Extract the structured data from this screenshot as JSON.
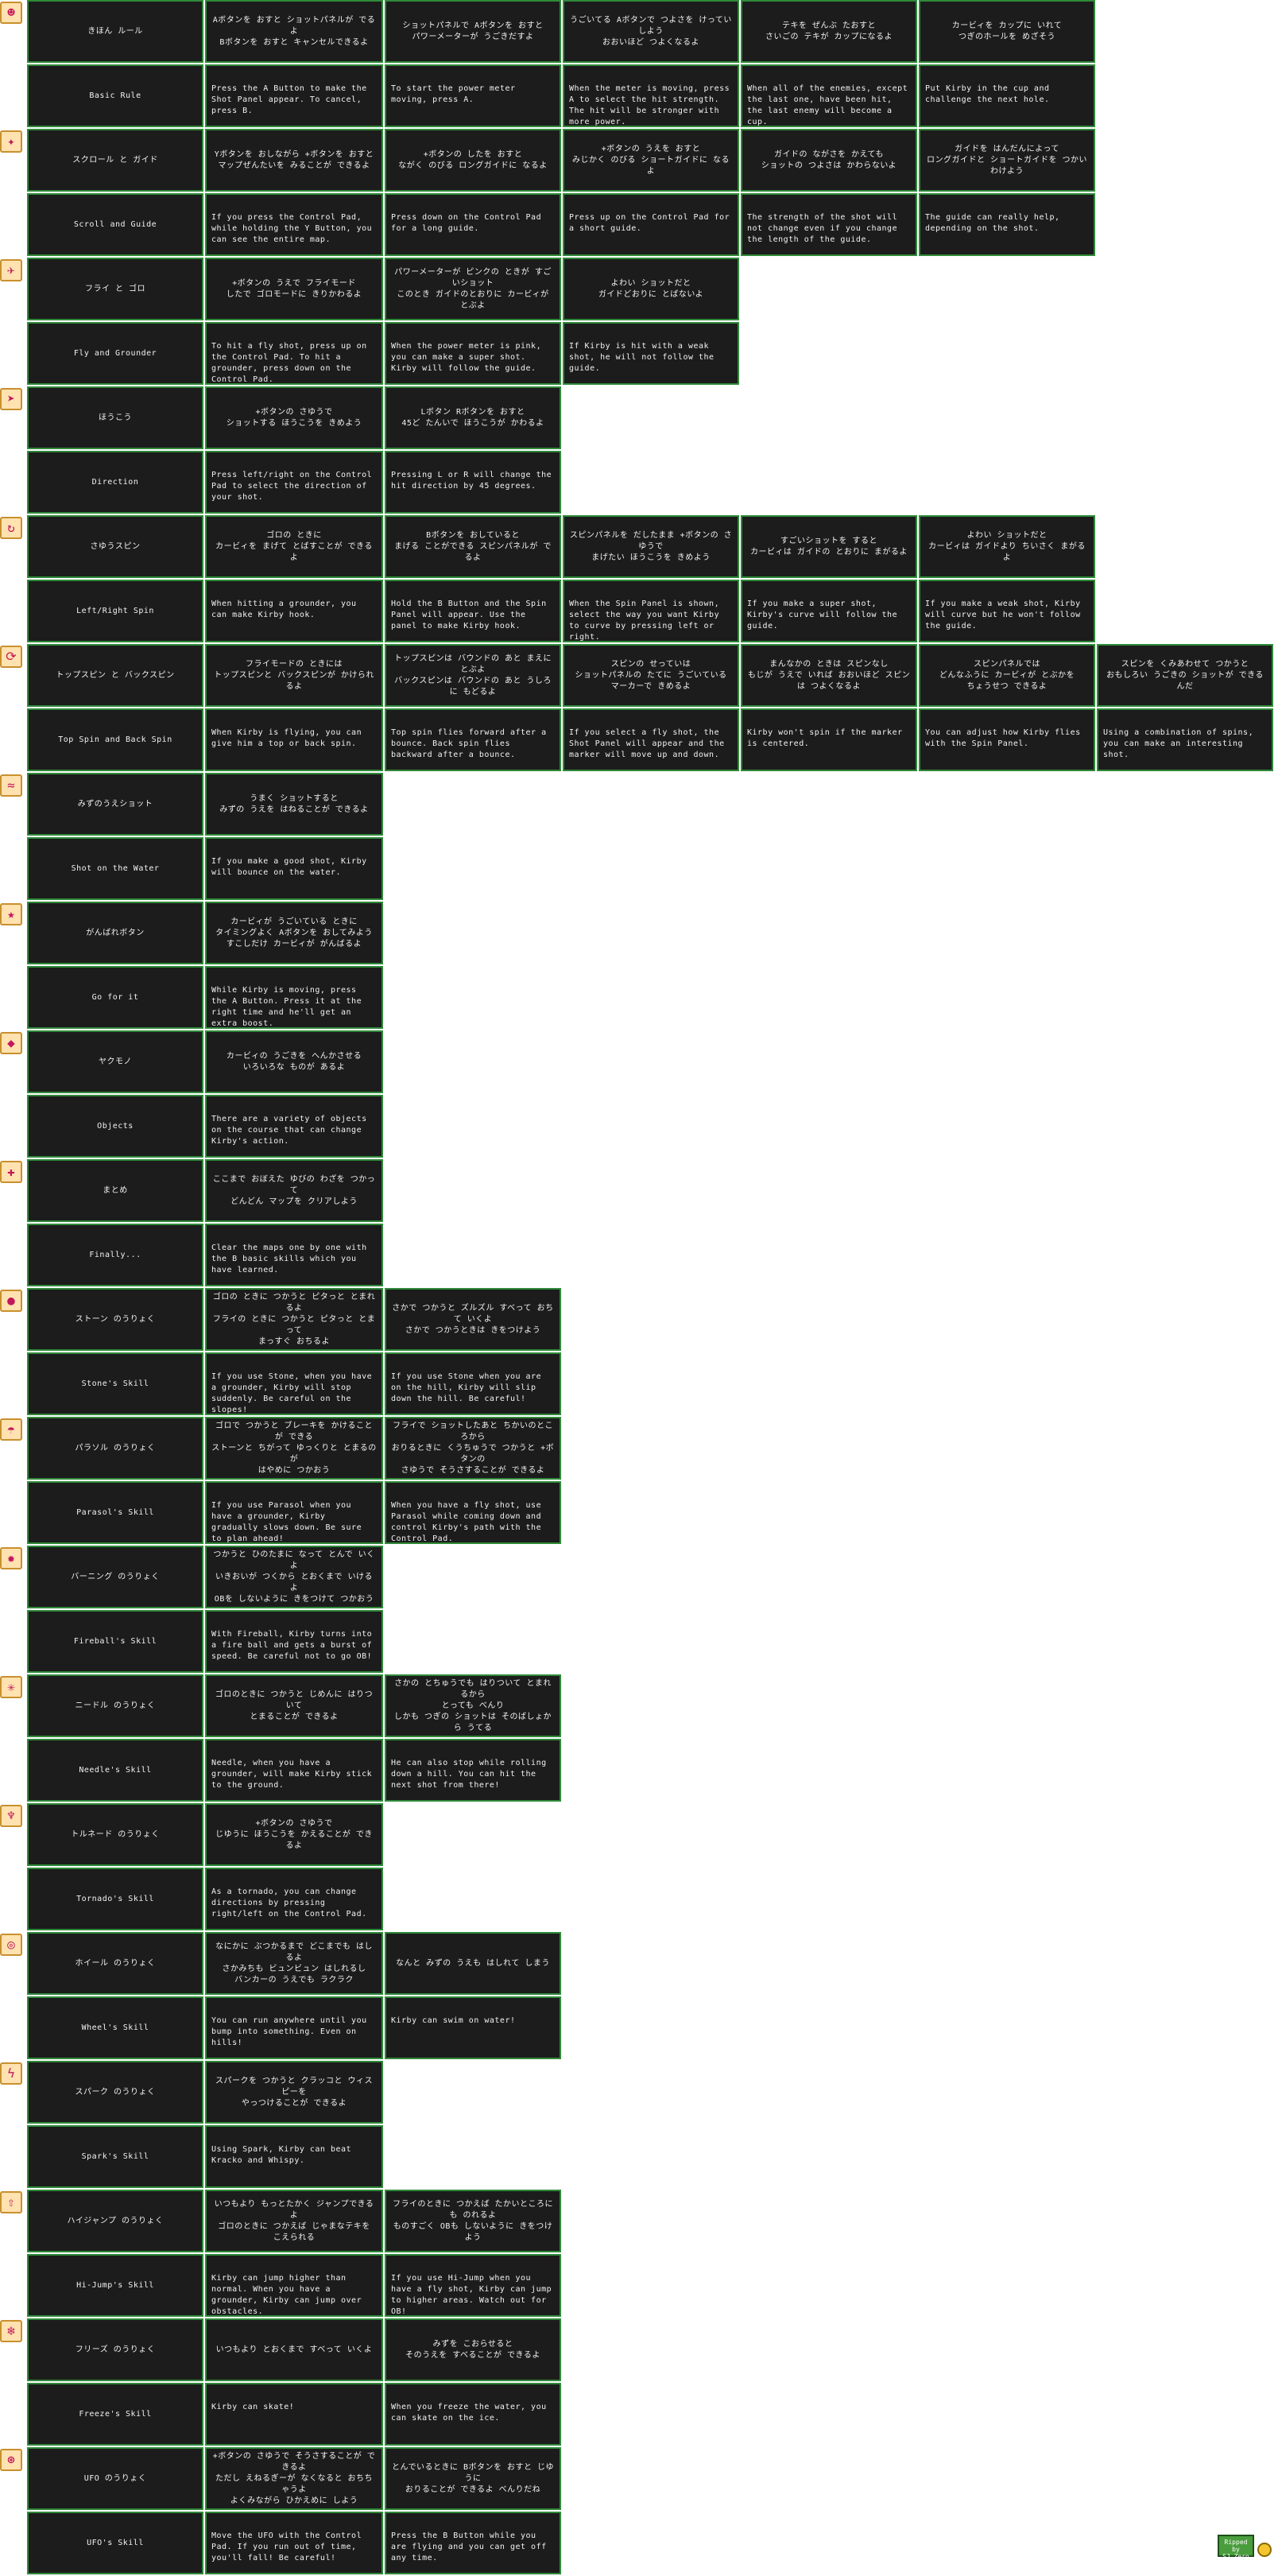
{
  "sections": [
    {
      "icon": "kirby-icon",
      "jp": "きほん ルール",
      "en": "Basic Rule",
      "cells": [
        {
          "jp": "Aボタンを おすと ショットパネルが でるよ\nBボタンを おすと キャンセルできるよ",
          "en": "Press the A Button to make the Shot Panel appear. To cancel, press B."
        },
        {
          "jp": "ショットパネルで Aボタンを おすと\nパワーメーターが うごきだすよ",
          "en": "To start the power meter moving, press A."
        },
        {
          "jp": "うごいてる Aボタンで つよさを けっていしよう\nおおいほど つよくなるよ",
          "en": "When the meter is moving, press A to select the hit strength. The hit will be stronger with more power."
        },
        {
          "jp": "テキを ぜんぶ たおすと\nさいごの テキが カップになるよ",
          "en": "When all of the enemies, except the last one, have been hit, the last enemy will become a cup."
        },
        {
          "jp": "カービィを カップに いれて\nつぎのホールを めざそう",
          "en": "Put Kirby in the cup and challenge the next hole."
        }
      ]
    },
    {
      "icon": "scroll-icon",
      "jp": "スクロール と ガイド",
      "en": "Scroll and Guide",
      "cells": [
        {
          "jp": "Yボタンを おしながら +ボタンを おすと\nマップぜんたいを みることが できるよ",
          "en": "If you press the Control Pad, while holding the Y Button, you can see the entire map."
        },
        {
          "jp": "+ボタンの したを おすと\nながく のびる ロングガイドに なるよ",
          "en": "Press down on the Control Pad for a long guide."
        },
        {
          "jp": "+ボタンの うえを おすと\nみじかく のびる ショートガイドに なるよ",
          "en": "Press up on the Control Pad for a short guide."
        },
        {
          "jp": "ガイドの ながさを かえても\nショットの つよさは かわらないよ",
          "en": "The strength of the shot will not change even if you change the length of the guide."
        },
        {
          "jp": "ガイドを はんだんによって\nロングガイドと ショートガイドを つかいわけよう",
          "en": "The guide can really help, depending on the shot."
        }
      ]
    },
    {
      "icon": "fly-icon",
      "jp": "フライ と ゴロ",
      "en": "Fly and Grounder",
      "cells": [
        {
          "jp": "+ボタンの うえで フライモード\nしたで ゴロモードに きりかわるよ",
          "en": "To hit a fly shot, press up on the Control Pad. To hit a grounder, press down on the Control Pad."
        },
        {
          "jp": "パワーメーターが ピンクの ときが すごいショット\nこのとき ガイドのとおりに カービィが とぶよ",
          "en": "When the power meter is pink, you can make a super shot. Kirby will follow the guide."
        },
        {
          "jp": "よわい ショットだと\nガイドどおりに とばないよ",
          "en": "If Kirby is hit with a weak shot, he will not follow the guide."
        }
      ]
    },
    {
      "icon": "arrow-icon",
      "jp": "ほうこう",
      "en": "Direction",
      "cells": [
        {
          "jp": "+ボタンの さゆうで\nショットする ほうこうを きめよう",
          "en": "Press left/right on the Control Pad to select the direction of your shot."
        },
        {
          "jp": "Lボタン Rボタンを おすと\n45ど たんいで ほうこうが かわるよ",
          "en": "Pressing L or R will change the hit direction by 45 degrees."
        }
      ]
    },
    {
      "icon": "spin-icon",
      "jp": "さゆうスピン",
      "en": "Left/Right Spin",
      "cells": [
        {
          "jp": "ゴロの ときに\nカービィを まげて とばすことが できるよ",
          "en": "When hitting a grounder, you can make Kirby hook."
        },
        {
          "jp": "Bボタンを おしていると\nまげる ことができる スピンパネルが でるよ",
          "en": "Hold the B Button and the Spin Panel will appear. Use the panel to make Kirby hook."
        },
        {
          "jp": "スピンパネルを だしたまま +ボタンの さゆうで\nまげたい ほうこうを きめよう",
          "en": "When the Spin Panel is shown, select the way you want Kirby to curve by pressing left or right."
        },
        {
          "jp": "すごいショットを すると\nカービィは ガイドの とおりに まがるよ",
          "en": "If you make a super shot, Kirby's curve will follow the guide."
        },
        {
          "jp": "よわい ショットだと\nカービィは ガイドより ちいさく まがるよ",
          "en": "If you make a weak shot, Kirby will curve but he won't follow the guide."
        }
      ]
    },
    {
      "icon": "topspin-icon",
      "jp": "トップスピン と バックスピン",
      "en": "Top Spin and Back Spin",
      "cells": [
        {
          "jp": "フライモードの ときには\nトップスピンと バックスピンが かけられるよ",
          "en": "When Kirby is flying, you can give him a top or back spin."
        },
        {
          "jp": "トップスピンは バウンドの あと まえに とぶよ\nバックスピンは バウンドの あと うしろに もどるよ",
          "en": "Top spin flies forward after a bounce. Back spin flies backward after a bounce."
        },
        {
          "jp": "スピンの せっていは\nショットパネルの たてに うごいている\nマーカーで きめるよ",
          "en": "If you select a fly shot, the Shot Panel will appear and the marker will move up and down."
        },
        {
          "jp": "まんなかの ときは スピンなし\nもじが うえで いれば おおいほど スピンは つよくなるよ",
          "en": "Kirby won't spin if the marker is centered."
        },
        {
          "jp": "スピンパネルでは\nどんなふうに カービィが とぶかを\nちょうせつ できるよ",
          "en": "You can adjust how Kirby flies with the Spin Panel."
        },
        {
          "jp": "スピンを くみあわせて つかうと\nおもしろい うごきの ショットが できるんだ",
          "en": "Using a combination of spins, you can make an interesting shot."
        }
      ]
    },
    {
      "icon": "water-icon",
      "jp": "みずのうえショット",
      "en": "Shot on the Water",
      "cells": [
        {
          "jp": "うまく ショットすると\nみずの うえを はねることが できるよ",
          "en": "If you make a good shot, Kirby will bounce on the water."
        }
      ]
    },
    {
      "icon": "dash-icon",
      "jp": "がんばれボタン",
      "en": "Go for it",
      "cells": [
        {
          "jp": "カービィが うごいている ときに\nタイミングよく Aボタンを おしてみよう\nすこしだけ カービィが がんばるよ",
          "en": "While Kirby is moving, press the A Button. Press it at the right time and he'll get an extra boost."
        }
      ]
    },
    {
      "icon": "object-icon",
      "jp": "ヤクモノ",
      "en": "Objects",
      "cells": [
        {
          "jp": "カービィの うごきを へんかさせる\nいろいろな ものが あるよ",
          "en": "There are a variety of objects on the course that can change Kirby's action."
        }
      ]
    },
    {
      "icon": "summary-icon",
      "jp": "まとめ",
      "en": "Finally...",
      "cells": [
        {
          "jp": "ここまで おぼえた ゆびの わざを つかって\nどんどん マップを クリアしよう",
          "en": "Clear the maps one by one with the B basic skills which you have learned."
        }
      ]
    },
    {
      "icon": "stone-icon",
      "jp": "ストーン のうりょく",
      "en": "Stone's Skill",
      "cells": [
        {
          "jp": "ゴロの ときに つかうと ピタっと とまれるよ\nフライの ときに つかうと ピタっと とまって\nまっすぐ おちるよ",
          "en": "If you use Stone, when you have a grounder, Kirby will stop suddenly. Be careful on the slopes!"
        },
        {
          "jp": "さかで つかうと ズルズル すべって おちて いくよ\nさかで つかうときは きをつけよう",
          "en": "If you use Stone when you are on the hill, Kirby will slip down the hill. Be careful!"
        }
      ]
    },
    {
      "icon": "parasol-icon",
      "jp": "パラソル のうりょく",
      "en": "Parasol's Skill",
      "cells": [
        {
          "jp": "ゴロで つかうと ブレーキを かけることが できる\nストーンと ちがって ゆっくりと とまるのが\nはやめに つかおう",
          "en": "If you use Parasol when you have a grounder, Kirby gradually slows down. Be sure to plan ahead!"
        },
        {
          "jp": "フライで ショットしたあと ちかいのところから\nおりるときに くうちゅうで つかうと +ボタンの\nさゆうで そうさすることが できるよ",
          "en": "When you have a fly shot, use Parasol while coming down and control Kirby's path with the Control Pad."
        }
      ]
    },
    {
      "icon": "fire-icon",
      "jp": "バーニング のうりょく",
      "en": "Fireball's Skill",
      "cells": [
        {
          "jp": "つかうと ひのたまに なって とんで いくよ\nいきおいが つくから とおくまで いけるよ\nOBを しないように きをつけて つかおう",
          "en": "With Fireball, Kirby turns into a fire ball and gets a burst of speed. Be careful not to go OB!"
        }
      ]
    },
    {
      "icon": "needle-icon",
      "jp": "ニードル のうりょく",
      "en": "Needle's Skill",
      "cells": [
        {
          "jp": "ゴロのときに つかうと じめんに はりついて\nとまることが できるよ",
          "en": "Needle, when you have a grounder, will make Kirby stick to the ground."
        },
        {
          "jp": "さかの とちゅうでも はりついて とまれるから\nとっても べんり\nしかも つぎの ショットは そのばしょから うてる",
          "en": "He can also stop while rolling down a hill. You can hit the next shot from there!"
        }
      ]
    },
    {
      "icon": "tornado-icon",
      "jp": "トルネード のうりょく",
      "en": "Tornado's Skill",
      "cells": [
        {
          "jp": "+ボタンの さゆうで\nじゆうに ほうこうを かえることが できるよ",
          "en": "As a tornado, you can change directions by pressing right/left on the Control Pad."
        }
      ]
    },
    {
      "icon": "wheel-icon",
      "jp": "ホイール のうりょく",
      "en": "Wheel's Skill",
      "cells": [
        {
          "jp": "なにかに ぶつかるまで どこまでも はしるよ\nさかみちも ビュンビュン はしれるし\nバンカーの うえでも ラクラク",
          "en": "You can run anywhere until you bump into something. Even on hills!"
        },
        {
          "jp": "なんと みずの うえも はしれて しまう",
          "en": "Kirby can swim on water!"
        }
      ]
    },
    {
      "icon": "spark-icon",
      "jp": "スパーク のうりょく",
      "en": "Spark's Skill",
      "cells": [
        {
          "jp": "スパークを つかうと クラッコと ウィスピーを\nやっつけることが できるよ",
          "en": "Using Spark, Kirby can beat Kracko and Whispy."
        }
      ]
    },
    {
      "icon": "hijump-icon",
      "jp": "ハイジャンプ のうりょく",
      "en": "Hi-Jump's Skill",
      "cells": [
        {
          "jp": "いつもより もっとたかく ジャンプできるよ\nゴロのときに つかえば じゃまなテキを こえられる",
          "en": "Kirby can jump higher than normal. When you have a grounder, Kirby can jump over obstacles."
        },
        {
          "jp": "フライのときに つかえば たかいところにも のれるよ\nものすごく OBも しないように きをつけよう",
          "en": "If you use Hi-Jump when you have a fly shot, Kirby can jump to higher areas. Watch out for OB!"
        }
      ]
    },
    {
      "icon": "freeze-icon",
      "jp": "フリーズ のうりょく",
      "en": "Freeze's Skill",
      "cells": [
        {
          "jp": "いつもより とおくまで すべって いくよ",
          "en": "Kirby can skate!"
        },
        {
          "jp": "みずを こおらせると\nそのうえを すべることが できるよ",
          "en": "When you freeze the water, you can skate on the ice."
        }
      ]
    },
    {
      "icon": "ufo-icon",
      "jp": "UFO のうりょく",
      "en": "UFO's Skill",
      "cells": [
        {
          "jp": "+ボタンの さゆうで そうさすることが できるよ\nただし えねるぎーが なくなると おちちゃうよ\nよくみながら ひかえめに しよう",
          "en": "Move the UFO with the Control Pad. If you run out of time, you'll fall! Be careful!"
        },
        {
          "jp": "とんでいるときに Bボタンを おすと じゆうに\nおりることが できるよ べんりだね",
          "en": "Press the B Button while you are flying and you can get off any time."
        }
      ]
    }
  ],
  "icon_glyphs": {
    "kirby-icon": "☻",
    "scroll-icon": "✦",
    "fly-icon": "✈",
    "arrow-icon": "➤",
    "spin-icon": "↻",
    "topspin-icon": "⟳",
    "water-icon": "≈",
    "dash-icon": "★",
    "object-icon": "◆",
    "summary-icon": "✚",
    "stone-icon": "●",
    "parasol-icon": "☂",
    "fire-icon": "✹",
    "needle-icon": "✳",
    "tornado-icon": "♆",
    "wheel-icon": "◎",
    "spark-icon": "ϟ",
    "hijump-icon": "⇧",
    "freeze-icon": "❄",
    "ufo-icon": "⊛"
  },
  "ripped": {
    "line1": "Ripped by",
    "line2": "SJ Zero"
  },
  "colors": {
    "cell_bg": "#1c1c1c",
    "cell_border": "#2f8a3a",
    "text": "#f2f2f2",
    "page_bg": "#ffffff"
  }
}
